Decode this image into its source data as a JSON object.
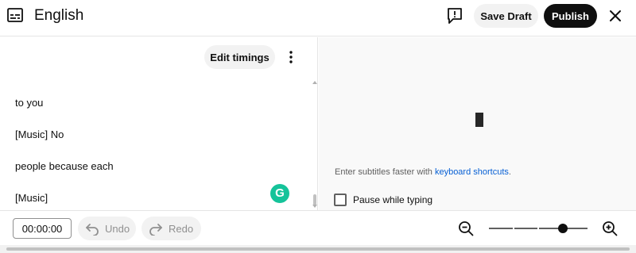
{
  "header": {
    "title": "English",
    "save_draft_label": "Save Draft",
    "publish_label": "Publish"
  },
  "editor": {
    "edit_timings_label": "Edit timings",
    "lines": [
      "to you",
      "[Music] No",
      "people because each",
      "[Music]"
    ]
  },
  "preview": {
    "tip_text": "Enter subtitles faster with ",
    "tip_link": "keyboard shortcuts",
    "tip_end": ".",
    "pause_label": "Pause while typing",
    "pause_checked": false
  },
  "toolbar": {
    "time_value": "00:00:00",
    "undo_label": "Undo",
    "redo_label": "Redo",
    "zoom_level": 0.75
  },
  "colors": {
    "accent": "#0f0f0f",
    "link": "#065fd4",
    "annotation_arrow": "#e60000",
    "grammarly": "#15c39a"
  },
  "icons": [
    "subtitles-icon",
    "feedback-icon",
    "close-icon",
    "more-vert-icon",
    "grammarly-icon",
    "undo-icon",
    "redo-icon",
    "zoom-out-icon",
    "zoom-in-icon"
  ]
}
